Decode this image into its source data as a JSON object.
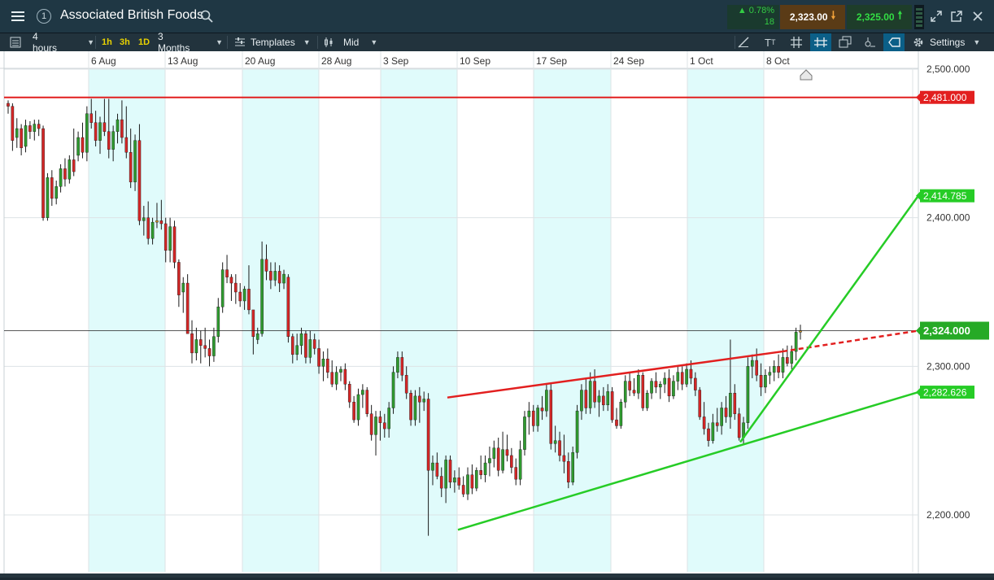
{
  "header": {
    "menu_icon": "hamburger-icon",
    "workspace_number": "1",
    "title": "Associated British Foods",
    "change_percent": "▲ 0.78%",
    "change_points": "18",
    "sell_price": "2,323.00",
    "buy_price": "2,325.00"
  },
  "toolbar": {
    "interval": "4 hours",
    "tf_1h": "1h",
    "tf_3h": "3h",
    "tf_1d": "1D",
    "range": "3 Months",
    "templates": "Templates",
    "price_type": "Mid",
    "settings": "Settings"
  },
  "colors": {
    "up": "#2f9a2f",
    "down": "#d32626",
    "doji": "#d89a2a",
    "band": "#e0fbfb",
    "red_line": "#e21f1f",
    "green_line": "#26cc26"
  },
  "chart_data": {
    "type": "candlestick",
    "x_dates": [
      "6 Aug",
      "13 Aug",
      "20 Aug",
      "28 Aug",
      "3 Sep",
      "10 Sep",
      "17 Sep",
      "24 Sep",
      "1 Oct",
      "8 Oct"
    ],
    "y_ticks": [
      "2,500.000",
      "2,400.000",
      "2,300.000",
      "2,200.000"
    ],
    "ylim": [
      2160,
      2505
    ],
    "price_labels": [
      {
        "text": "2,481.000",
        "value": 2481,
        "color": "#e21f1f"
      },
      {
        "text": "2,414.785",
        "value": 2414.785,
        "color": "#26cc26"
      },
      {
        "text": "2,324.000",
        "value": 2324,
        "color": "#26aa26"
      },
      {
        "text": "2,282.626",
        "value": 2282.626,
        "color": "#26cc26"
      }
    ],
    "current_price": 2324,
    "resistance_level": 2481,
    "candles": [
      [
        2477,
        2479,
        2470,
        2475
      ],
      [
        2475,
        2477,
        2445,
        2452
      ],
      [
        2454,
        2467,
        2447,
        2460
      ],
      [
        2460,
        2463,
        2442,
        2447
      ],
      [
        2448,
        2466,
        2444,
        2462
      ],
      [
        2462,
        2465,
        2453,
        2458
      ],
      [
        2458,
        2466,
        2452,
        2463
      ],
      [
        2463,
        2466,
        2455,
        2460
      ],
      [
        2460,
        2462,
        2398,
        2400
      ],
      [
        2400,
        2430,
        2398,
        2427
      ],
      [
        2427,
        2432,
        2408,
        2413
      ],
      [
        2413,
        2425,
        2409,
        2421
      ],
      [
        2421,
        2436,
        2417,
        2433
      ],
      [
        2433,
        2440,
        2421,
        2426
      ],
      [
        2426,
        2442,
        2423,
        2439
      ],
      [
        2439,
        2460,
        2428,
        2431
      ],
      [
        2442,
        2458,
        2438,
        2454
      ],
      [
        2454,
        2464,
        2440,
        2444
      ],
      [
        2444,
        2475,
        2438,
        2470
      ],
      [
        2470,
        2480,
        2460,
        2464
      ],
      [
        2464,
        2472,
        2448,
        2452
      ],
      [
        2452,
        2468,
        2443,
        2464
      ],
      [
        2464,
        2480,
        2455,
        2458
      ],
      [
        2458,
        2480,
        2440,
        2446
      ],
      [
        2446,
        2462,
        2438,
        2458
      ],
      [
        2458,
        2470,
        2450,
        2466
      ],
      [
        2466,
        2479,
        2450,
        2454
      ],
      [
        2454,
        2475,
        2440,
        2444
      ],
      [
        2444,
        2460,
        2420,
        2424
      ],
      [
        2424,
        2456,
        2418,
        2452
      ],
      [
        2452,
        2463,
        2395,
        2398
      ],
      [
        2398,
        2408,
        2388,
        2400
      ],
      [
        2400,
        2411,
        2382,
        2386
      ],
      [
        2386,
        2400,
        2382,
        2397
      ],
      [
        2397,
        2410,
        2393,
        2398
      ],
      [
        2398,
        2412,
        2392,
        2396
      ],
      [
        2396,
        2400,
        2370,
        2378
      ],
      [
        2378,
        2400,
        2370,
        2394
      ],
      [
        2394,
        2398,
        2366,
        2370
      ],
      [
        2370,
        2372,
        2340,
        2348
      ],
      [
        2350,
        2360,
        2336,
        2356
      ],
      [
        2356,
        2362,
        2334,
        2322
      ],
      [
        2322,
        2331,
        2302,
        2309
      ],
      [
        2309,
        2326,
        2304,
        2318
      ],
      [
        2318,
        2324,
        2302,
        2314
      ],
      [
        2314,
        2326,
        2306,
        2312
      ],
      [
        2312,
        2318,
        2300,
        2307
      ],
      [
        2307,
        2326,
        2303,
        2320
      ],
      [
        2320,
        2346,
        2316,
        2340
      ],
      [
        2340,
        2370,
        2336,
        2365
      ],
      [
        2365,
        2375,
        2356,
        2360
      ],
      [
        2360,
        2362,
        2344,
        2356
      ],
      [
        2356,
        2362,
        2342,
        2350
      ],
      [
        2350,
        2356,
        2340,
        2344
      ],
      [
        2344,
        2354,
        2338,
        2352
      ],
      [
        2352,
        2368,
        2335,
        2338
      ],
      [
        2338,
        2328,
        2308,
        2320
      ],
      [
        2318,
        2326,
        2315,
        2322
      ],
      [
        2322,
        2384,
        2320,
        2372
      ],
      [
        2372,
        2382,
        2358,
        2364
      ],
      [
        2364,
        2370,
        2352,
        2358
      ],
      [
        2358,
        2370,
        2354,
        2364
      ],
      [
        2364,
        2368,
        2350,
        2356
      ],
      [
        2356,
        2365,
        2352,
        2362
      ],
      [
        2360,
        2362,
        2316,
        2320
      ],
      [
        2320,
        2322,
        2302,
        2308
      ],
      [
        2308,
        2322,
        2304,
        2314
      ],
      [
        2314,
        2326,
        2308,
        2322
      ],
      [
        2322,
        2324,
        2302,
        2306
      ],
      [
        2306,
        2324,
        2302,
        2318
      ],
      [
        2318,
        2322,
        2308,
        2312
      ],
      [
        2312,
        2318,
        2295,
        2300
      ],
      [
        2300,
        2310,
        2290,
        2305
      ],
      [
        2305,
        2312,
        2292,
        2296
      ],
      [
        2296,
        2304,
        2286,
        2288
      ],
      [
        2288,
        2300,
        2284,
        2296
      ],
      [
        2296,
        2300,
        2290,
        2298
      ],
      [
        2298,
        2302,
        2284,
        2288
      ],
      [
        2288,
        2290,
        2272,
        2276
      ],
      [
        2276,
        2280,
        2262,
        2264
      ],
      [
        2264,
        2285,
        2260,
        2281
      ],
      [
        2281,
        2288,
        2272,
        2284
      ],
      [
        2284,
        2286,
        2266,
        2268
      ],
      [
        2268,
        2274,
        2250,
        2254
      ],
      [
        2254,
        2270,
        2240,
        2266
      ],
      [
        2266,
        2270,
        2250,
        2262
      ],
      [
        2262,
        2268,
        2252,
        2258
      ],
      [
        2258,
        2276,
        2252,
        2272
      ],
      [
        2272,
        2300,
        2268,
        2296
      ],
      [
        2296,
        2310,
        2292,
        2306
      ],
      [
        2306,
        2310,
        2290,
        2294
      ],
      [
        2294,
        2300,
        2278,
        2282
      ],
      [
        2282,
        2284,
        2260,
        2264
      ],
      [
        2264,
        2284,
        2260,
        2280
      ],
      [
        2280,
        2286,
        2262,
        2276
      ],
      [
        2276,
        2283,
        2270,
        2278
      ],
      [
        2278,
        2282,
        2186,
        2230
      ],
      [
        2230,
        2240,
        2220,
        2235
      ],
      [
        2235,
        2242,
        2224,
        2226
      ],
      [
        2226,
        2232,
        2212,
        2218
      ],
      [
        2218,
        2240,
        2208,
        2237
      ],
      [
        2237,
        2240,
        2218,
        2222
      ],
      [
        2222,
        2230,
        2215,
        2225
      ],
      [
        2225,
        2232,
        2217,
        2220
      ],
      [
        2220,
        2226,
        2212,
        2214
      ],
      [
        2214,
        2232,
        2210,
        2227
      ],
      [
        2227,
        2234,
        2214,
        2218
      ],
      [
        2218,
        2232,
        2216,
        2230
      ],
      [
        2230,
        2240,
        2224,
        2227
      ],
      [
        2227,
        2240,
        2222,
        2235
      ],
      [
        2235,
        2246,
        2226,
        2238
      ],
      [
        2238,
        2250,
        2232,
        2245
      ],
      [
        2245,
        2252,
        2226,
        2230
      ],
      [
        2230,
        2256,
        2228,
        2244
      ],
      [
        2244,
        2254,
        2236,
        2240
      ],
      [
        2240,
        2245,
        2228,
        2232
      ],
      [
        2232,
        2238,
        2220,
        2224
      ],
      [
        2224,
        2250,
        2220,
        2244
      ],
      [
        2244,
        2270,
        2240,
        2266
      ],
      [
        2266,
        2276,
        2254,
        2270
      ],
      [
        2270,
        2274,
        2256,
        2260
      ],
      [
        2260,
        2274,
        2256,
        2272
      ],
      [
        2272,
        2280,
        2264,
        2270
      ],
      [
        2270,
        2288,
        2266,
        2284
      ],
      [
        2284,
        2288,
        2244,
        2248
      ],
      [
        2248,
        2260,
        2242,
        2250
      ],
      [
        2250,
        2256,
        2236,
        2240
      ],
      [
        2240,
        2254,
        2228,
        2236
      ],
      [
        2236,
        2242,
        2218,
        2222
      ],
      [
        2222,
        2246,
        2220,
        2242
      ],
      [
        2242,
        2274,
        2238,
        2270
      ],
      [
        2270,
        2288,
        2264,
        2284
      ],
      [
        2284,
        2292,
        2268,
        2272
      ],
      [
        2272,
        2296,
        2268,
        2290
      ],
      [
        2290,
        2298,
        2272,
        2276
      ],
      [
        2276,
        2284,
        2266,
        2280
      ],
      [
        2280,
        2286,
        2270,
        2274
      ],
      [
        2274,
        2288,
        2270,
        2283
      ],
      [
        2283,
        2286,
        2262,
        2264
      ],
      [
        2264,
        2272,
        2258,
        2260
      ],
      [
        2260,
        2278,
        2258,
        2276
      ],
      [
        2276,
        2294,
        2272,
        2290
      ],
      [
        2290,
        2296,
        2280,
        2284
      ],
      [
        2284,
        2292,
        2280,
        2282
      ],
      [
        2282,
        2298,
        2278,
        2294
      ],
      [
        2294,
        2296,
        2270,
        2272
      ],
      [
        2272,
        2284,
        2270,
        2282
      ],
      [
        2282,
        2292,
        2278,
        2290
      ],
      [
        2290,
        2296,
        2282,
        2286
      ],
      [
        2286,
        2290,
        2278,
        2288
      ],
      [
        2288,
        2296,
        2282,
        2292
      ],
      [
        2292,
        2298,
        2276,
        2280
      ],
      [
        2280,
        2294,
        2278,
        2290
      ],
      [
        2290,
        2300,
        2284,
        2296
      ],
      [
        2296,
        2300,
        2284,
        2288
      ],
      [
        2288,
        2302,
        2286,
        2298
      ],
      [
        2298,
        2304,
        2288,
        2292
      ],
      [
        2292,
        2296,
        2280,
        2284
      ],
      [
        2284,
        2286,
        2264,
        2266
      ],
      [
        2266,
        2276,
        2254,
        2258
      ],
      [
        2258,
        2262,
        2246,
        2250
      ],
      [
        2250,
        2268,
        2248,
        2262
      ],
      [
        2262,
        2272,
        2256,
        2260
      ],
      [
        2260,
        2276,
        2254,
        2272
      ],
      [
        2272,
        2280,
        2262,
        2266
      ],
      [
        2266,
        2318,
        2258,
        2282
      ],
      [
        2282,
        2288,
        2264,
        2268
      ],
      [
        2268,
        2272,
        2250,
        2252
      ],
      [
        2252,
        2266,
        2248,
        2262
      ],
      [
        2262,
        2306,
        2258,
        2300
      ],
      [
        2300,
        2308,
        2292,
        2304
      ],
      [
        2304,
        2312,
        2290,
        2294
      ],
      [
        2294,
        2302,
        2280,
        2286
      ],
      [
        2286,
        2298,
        2282,
        2294
      ],
      [
        2294,
        2300,
        2288,
        2296
      ],
      [
        2296,
        2304,
        2290,
        2300
      ],
      [
        2300,
        2308,
        2292,
        2296
      ],
      [
        2296,
        2312,
        2292,
        2306
      ],
      [
        2306,
        2314,
        2300,
        2302
      ],
      [
        2302,
        2314,
        2298,
        2310
      ],
      [
        2310,
        2326,
        2304,
        2323
      ],
      [
        2323,
        2328,
        2318,
        2324
      ]
    ],
    "trendlines": [
      {
        "color": "red",
        "style": "solid",
        "from": [
          "10 Sep",
          2279
        ],
        "to": [
          "8 Oct",
          2310
        ]
      },
      {
        "color": "red",
        "style": "dashed",
        "from": [
          "8 Oct",
          2310
        ],
        "to": [
          "end",
          2324
        ]
      },
      {
        "color": "green",
        "from": [
          "10 Sep",
          2190
        ],
        "to": [
          "end",
          2282.626
        ]
      },
      {
        "color": "green",
        "from": [
          "5 Oct",
          2249
        ],
        "to": [
          "end",
          2414.785
        ]
      }
    ]
  }
}
